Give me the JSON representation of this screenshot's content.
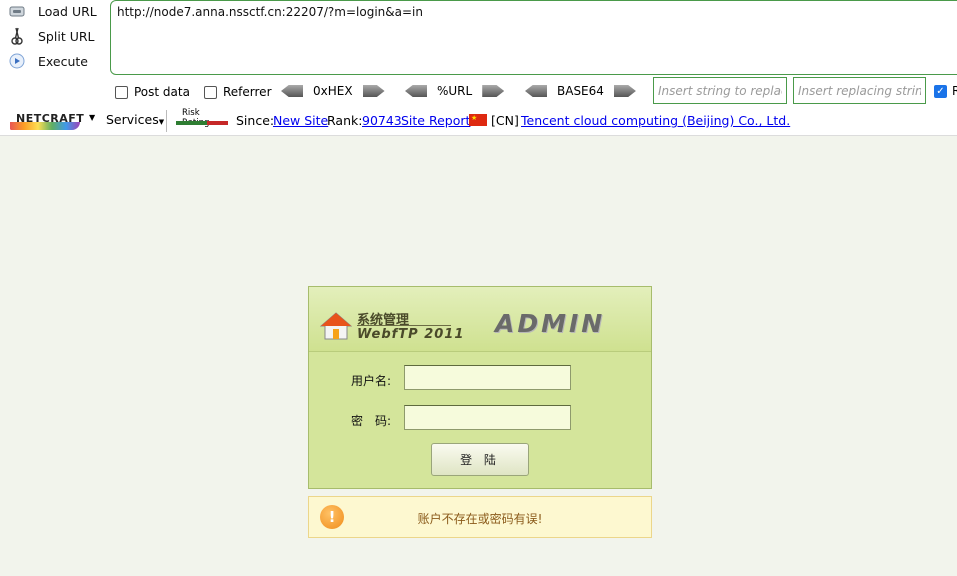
{
  "hackbar": {
    "buttons": [
      {
        "label": "Load URL",
        "icon": "load-url-icon"
      },
      {
        "label": "Split URL",
        "icon": "scissors-icon"
      },
      {
        "label": "Execute",
        "icon": "play-icon"
      }
    ],
    "url": "http://node7.anna.nssctf.cn:22207/?m=login&a=in",
    "post_data_label": "Post data",
    "referrer_label": "Referrer",
    "encoders": [
      "0xHEX",
      "%URL",
      "BASE64"
    ],
    "replace_placeholder": "Insert string to replace",
    "replacing_placeholder": "Insert replacing string",
    "replace_checkbox_label": "R"
  },
  "netcraft": {
    "logo_text": "NETCRAFT",
    "services_label": "Services",
    "risk_label": "Risk Rating",
    "since_label": "Since:",
    "since_value": "New Site",
    "rank_label": "Rank:",
    "rank_value": "90743",
    "site_report": "Site Report",
    "country_code": "[CN]",
    "host": "Tencent cloud computing (Beijing) Co., Ltd."
  },
  "login": {
    "system_title": "系统管理",
    "system_subtitle": "WebfTP 2011",
    "admin_logo": "ADMIN",
    "username_label": "用户名:",
    "password_label": "密　码:",
    "username_value": "",
    "password_value": "",
    "submit_label": "登 陆"
  },
  "error": {
    "message": "账户不存在或密码有误!"
  },
  "colors": {
    "panel_bg": "#d4e59b",
    "error_bg": "#fdf8d0",
    "page_bg": "#f2f4ec",
    "hackbar_border": "#4a9a4a"
  }
}
